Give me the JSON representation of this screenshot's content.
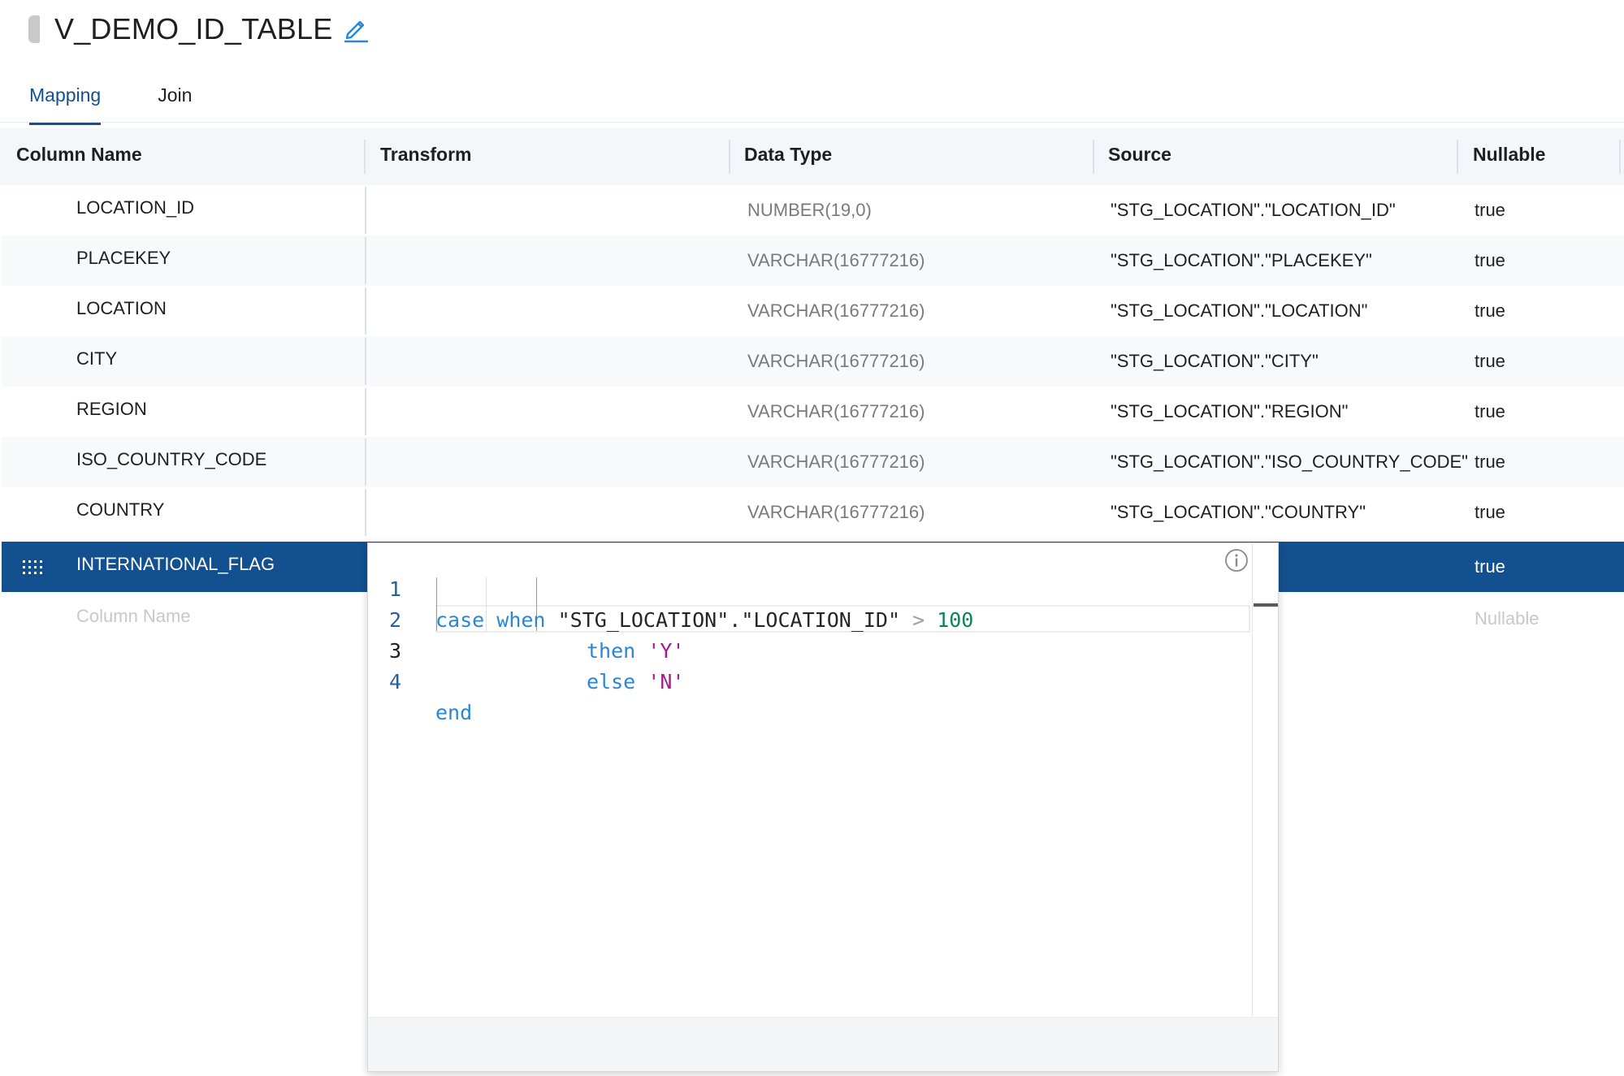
{
  "title": "V_DEMO_ID_TABLE",
  "tabs": [
    {
      "label": "Mapping",
      "active": true
    },
    {
      "label": "Join",
      "active": false
    }
  ],
  "columns": {
    "column_name": "Column Name",
    "transform": "Transform",
    "data_type": "Data Type",
    "source": "Source",
    "nullable": "Nullable"
  },
  "rows": [
    {
      "name": "LOCATION_ID",
      "data_type": "NUMBER(19,0)",
      "source": "\"STG_LOCATION\".\"LOCATION_ID\"",
      "nullable": "true"
    },
    {
      "name": "PLACEKEY",
      "data_type": "VARCHAR(16777216)",
      "source": "\"STG_LOCATION\".\"PLACEKEY\"",
      "nullable": "true"
    },
    {
      "name": "LOCATION",
      "data_type": "VARCHAR(16777216)",
      "source": "\"STG_LOCATION\".\"LOCATION\"",
      "nullable": "true"
    },
    {
      "name": "CITY",
      "data_type": "VARCHAR(16777216)",
      "source": "\"STG_LOCATION\".\"CITY\"",
      "nullable": "true"
    },
    {
      "name": "REGION",
      "data_type": "VARCHAR(16777216)",
      "source": "\"STG_LOCATION\".\"REGION\"",
      "nullable": "true"
    },
    {
      "name": "ISO_COUNTRY_CODE",
      "data_type": "VARCHAR(16777216)",
      "source": "\"STG_LOCATION\".\"ISO_COUNTRY_CODE\"",
      "nullable": "true"
    },
    {
      "name": "COUNTRY",
      "data_type": "VARCHAR(16777216)",
      "source": "\"STG_LOCATION\".\"COUNTRY\"",
      "nullable": "true"
    },
    {
      "name": "INTERNATIONAL_FLAG",
      "data_type": "",
      "source": "",
      "nullable": "true",
      "selected": true
    }
  ],
  "new_row": {
    "name_placeholder": "Column Name",
    "nullable_placeholder": "Nullable"
  },
  "editor": {
    "line_numbers": [
      "1",
      "2",
      "3",
      "4"
    ],
    "tokens": {
      "case": "case",
      "when": "when",
      "source_ref": "\"STG_LOCATION\".\"LOCATION_ID\"",
      "op": ">",
      "num": "100",
      "then": "then",
      "val_y": "'Y'",
      "else": "else",
      "val_n": "'N'",
      "end": "end"
    }
  },
  "colors": {
    "accent": "#13508f",
    "keyword": "#2a86d6",
    "number": "#098658",
    "literal": "#a31c8a"
  }
}
